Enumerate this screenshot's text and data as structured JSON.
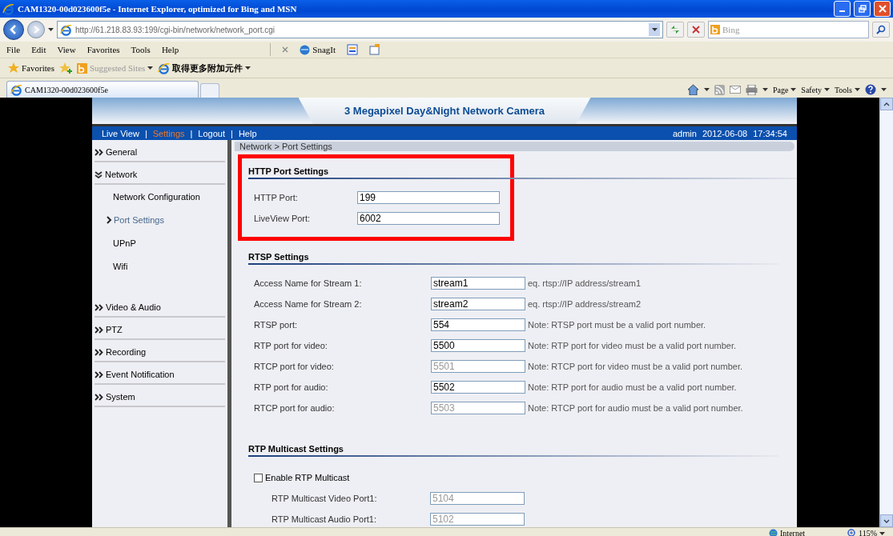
{
  "window": {
    "title": "CAM1320-00d023600f5e - Internet Explorer, optimized for Bing and MSN"
  },
  "address_bar": {
    "url": "http://61.218.83.93:199/cgi-bin/network/network_port.cgi",
    "search_placeholder": "Bing"
  },
  "menu": [
    "File",
    "Edit",
    "View",
    "Favorites",
    "Tools",
    "Help"
  ],
  "toolbar": {
    "snagit": "SnagIt"
  },
  "favorites_bar": {
    "favorites": "Favorites",
    "suggested": "Suggested Sites",
    "addons": "取得更多附加元件"
  },
  "tab": {
    "title": "CAM1320-00d023600f5e"
  },
  "command_bar": [
    "Page",
    "Safety",
    "Tools"
  ],
  "page": {
    "title": "3 Megapixel Day&Night Network Camera",
    "nav": [
      {
        "label": "Live View",
        "selected": false,
        "separator": "|"
      },
      {
        "label": "Settings",
        "selected": true,
        "separator": "|"
      },
      {
        "label": "Logout",
        "selected": false,
        "separator": "|"
      },
      {
        "label": "Help",
        "selected": false
      }
    ],
    "user": "admin",
    "date": "2012-06-08",
    "time": "17:34:54",
    "breadcrumb": "Network > Port Settings",
    "sidebar": [
      {
        "label": "General",
        "expanded": false
      },
      {
        "label": "Network",
        "expanded": true,
        "children": [
          {
            "label": "Network Configuration",
            "selected": false
          },
          {
            "label": "Port Settings",
            "selected": true
          },
          {
            "label": "UPnP",
            "selected": false
          },
          {
            "label": "Wifi",
            "selected": false
          }
        ]
      },
      {
        "label": "Video & Audio",
        "expanded": false
      },
      {
        "label": "PTZ",
        "expanded": false
      },
      {
        "label": "Recording",
        "expanded": false
      },
      {
        "label": "Event Notification",
        "expanded": false
      },
      {
        "label": "System",
        "expanded": false
      }
    ],
    "sections": [
      {
        "kind": "basic",
        "title": "HTTP Port Settings",
        "highlighted": true,
        "rows": [
          {
            "label": "HTTP Port:",
            "value": "199",
            "disabled": false
          },
          {
            "label": "LiveView Port:",
            "value": "6002",
            "disabled": false
          }
        ]
      },
      {
        "kind": "notes",
        "title": "RTSP Settings",
        "highlighted": false,
        "rows": [
          {
            "label": "Access Name for Stream 1:",
            "value": "stream1",
            "disabled": false,
            "note": "eq. rtsp://IP address/stream1"
          },
          {
            "label": "Access Name for Stream 2:",
            "value": "stream2",
            "disabled": false,
            "note": "eq. rtsp://IP address/stream2"
          },
          {
            "label": "RTSP port:",
            "value": "554",
            "disabled": false,
            "note": "Note: RTSP port must be a valid port number."
          },
          {
            "label": "RTP port for video:",
            "value": "5500",
            "disabled": false,
            "note": "Note: RTP port for video must be a valid port number."
          },
          {
            "label": "RTCP port for video:",
            "value": "5501",
            "disabled": true,
            "note": "Note: RTCP port for video must be a valid port number."
          },
          {
            "label": "RTP port for audio:",
            "value": "5502",
            "disabled": false,
            "note": "Note: RTP port for audio must be a valid port number."
          },
          {
            "label": "RTCP port for audio:",
            "value": "5503",
            "disabled": true,
            "note": "Note: RTCP port for audio must be a valid port number."
          }
        ]
      },
      {
        "kind": "multicast",
        "title": "RTP Multicast Settings",
        "highlighted": false,
        "checkbox": {
          "label": "Enable RTP Multicast",
          "checked": false
        },
        "rows": [
          {
            "label": "RTP Multicast Video Port1:",
            "value": "5104",
            "disabled": true
          },
          {
            "label": "RTP Multicast Audio Port1:",
            "value": "5102",
            "disabled": true
          }
        ]
      }
    ]
  },
  "status_bar": {
    "zone": "Internet",
    "zoom": "115%"
  }
}
